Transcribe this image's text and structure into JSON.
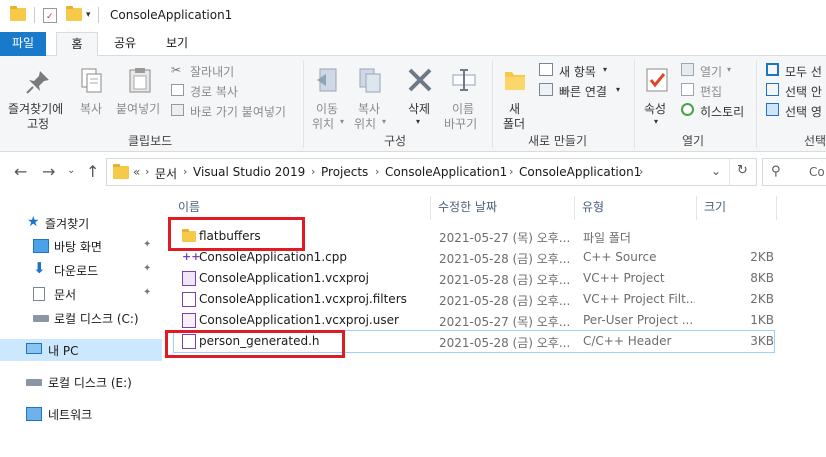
{
  "window": {
    "title": "ConsoleApplication1"
  },
  "ribbon": {
    "tabs": [
      "파일",
      "홈",
      "공유",
      "보기"
    ],
    "clipboard": {
      "pin_label_1": "즐겨찾기에",
      "pin_label_2": "고정",
      "copy": "복사",
      "paste": "붙여넣기",
      "cut": "잘라내기",
      "copy_path": "경로 복사",
      "paste_shortcut": "바로 가기 붙여넣기",
      "group": "클립보드"
    },
    "organize": {
      "move_1": "이동",
      "move_2": "위치",
      "copy_1": "복사",
      "copy_2": "위치",
      "delete": "삭제",
      "rename_1": "이름",
      "rename_2": "바꾸기",
      "group": "구성"
    },
    "new": {
      "folder_1": "새",
      "folder_2": "폴더",
      "new_item": "새 항목",
      "easy_access": "빠른 연결",
      "group": "새로 만들기"
    },
    "open": {
      "properties": "속성",
      "open": "열기",
      "edit": "편집",
      "history": "히스토리",
      "group": "열기"
    },
    "select": {
      "select_all": "모두 선",
      "select_none": "선택 안",
      "invert": "선택 영",
      "group": "선택"
    }
  },
  "address": {
    "overflow": "«",
    "crumbs": [
      "문서",
      "Visual Studio 2019",
      "Projects",
      "ConsoleApplication1",
      "ConsoleApplication1"
    ],
    "search_placeholder": "Co"
  },
  "nav": {
    "items": [
      {
        "label": "즐겨찾기",
        "icon": "star-icon"
      },
      {
        "label": "바탕 화면",
        "icon": "desktop-icon"
      },
      {
        "label": "다운로드",
        "icon": "download-icon"
      },
      {
        "label": "문서",
        "icon": "document-icon"
      },
      {
        "label": "로컬 디스크 (C:)",
        "icon": "drive-icon"
      },
      {
        "label": "내 PC",
        "icon": "pc-icon"
      },
      {
        "label": "로컬 디스크 (E:)",
        "icon": "drive-icon"
      },
      {
        "label": "네트워크",
        "icon": "network-icon"
      }
    ]
  },
  "list": {
    "columns": [
      "이름",
      "수정한 날짜",
      "유형",
      "크기"
    ],
    "rows": [
      {
        "name": "flatbuffers",
        "date": "2021-05-27 (목) 오후...",
        "type": "파일 폴더",
        "size": "",
        "icon": "folder-icon"
      },
      {
        "name": "ConsoleApplication1.cpp",
        "date": "2021-05-28 (금) 오후...",
        "type": "C++ Source",
        "size": "2KB",
        "icon": "cpp-file-icon"
      },
      {
        "name": "ConsoleApplication1.vcxproj",
        "date": "2021-05-28 (금) 오후...",
        "type": "VC++ Project",
        "size": "8KB",
        "icon": "vcxproj-file-icon"
      },
      {
        "name": "ConsoleApplication1.vcxproj.filters",
        "date": "2021-05-28 (금) 오후...",
        "type": "VC++ Project Filt...",
        "size": "2KB",
        "icon": "filters-file-icon"
      },
      {
        "name": "ConsoleApplication1.vcxproj.user",
        "date": "2021-05-27 (목) 오후...",
        "type": "Per-User Project ...",
        "size": "1KB",
        "icon": "user-file-icon"
      },
      {
        "name": "person_generated.h",
        "date": "2021-05-28 (금) 오후...",
        "type": "C/C++ Header",
        "size": "3KB",
        "icon": "header-file-icon"
      }
    ]
  },
  "colors": {
    "accent": "#1979ca",
    "highlight": "#e01b24",
    "selected": "#cce8ff"
  }
}
